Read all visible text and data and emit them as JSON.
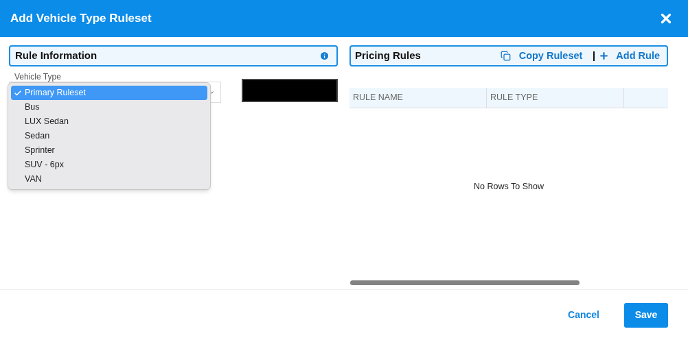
{
  "dialog": {
    "title": "Add Vehicle Type Ruleset"
  },
  "rule_information": {
    "title": "Rule Information",
    "vehicle_type": {
      "label": "Vehicle Type",
      "options": [
        {
          "label": "Primary Ruleset",
          "selected": true
        },
        {
          "label": "Bus",
          "selected": false
        },
        {
          "label": "LUX Sedan",
          "selected": false
        },
        {
          "label": "Sedan",
          "selected": false
        },
        {
          "label": "Sprinter",
          "selected": false
        },
        {
          "label": "SUV - 6px",
          "selected": false
        },
        {
          "label": "VAN",
          "selected": false
        }
      ]
    }
  },
  "pricing_rules": {
    "title": "Pricing Rules",
    "actions": [
      {
        "kind": "copy",
        "label": "Copy Ruleset"
      },
      {
        "kind": "add",
        "label": "Add Rule"
      }
    ],
    "table": {
      "columns": [
        "RULE NAME",
        "RULE TYPE"
      ],
      "empty_message": "No Rows To Show"
    }
  },
  "footer": {
    "cancel": "Cancel",
    "save": "Save"
  }
}
